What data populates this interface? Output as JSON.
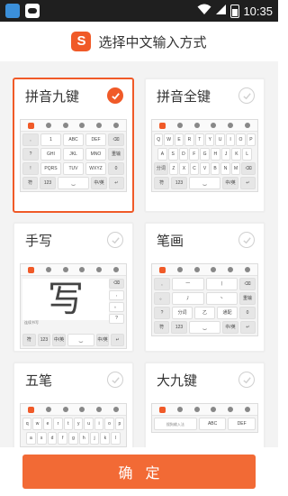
{
  "status_bar": {
    "time": "10:35"
  },
  "header": {
    "logo_char": "S",
    "title": "选择中文输入方式"
  },
  "colors": {
    "accent": "#f05a28",
    "button": "#f26a35"
  },
  "options": [
    {
      "title": "拼音九键",
      "selected": true,
      "keyboard": {
        "rows": [
          [
            ",",
            "1",
            "ABC",
            "DEF",
            "⌫"
          ],
          [
            "?",
            "GHI",
            "JKL",
            "MNO",
            "重输"
          ],
          [
            "!",
            "PQRS",
            "TUV",
            "WXYZ",
            "0"
          ],
          [
            "符",
            "123",
            "‿",
            "中/英",
            "↵"
          ]
        ]
      }
    },
    {
      "title": "拼音全键",
      "selected": false,
      "keyboard": {
        "rows": [
          [
            "Q",
            "W",
            "E",
            "R",
            "T",
            "Y",
            "U",
            "I",
            "O",
            "P"
          ],
          [
            "A",
            "S",
            "D",
            "F",
            "G",
            "H",
            "J",
            "K",
            "L"
          ],
          [
            "分词",
            "Z",
            "X",
            "C",
            "V",
            "B",
            "N",
            "M",
            "⌫"
          ],
          [
            "符",
            "123",
            "‿",
            "中/英",
            "↵"
          ]
        ]
      }
    },
    {
      "title": "手写",
      "selected": false,
      "handwriting_char": "写",
      "handwriting_caption": "连续书写",
      "side_keys": [
        "⌫",
        ",",
        "。",
        "?",
        "!"
      ],
      "bottom_keys": [
        "符",
        "123",
        "中/英",
        "‿",
        "中/英",
        "↵"
      ]
    },
    {
      "title": "笔画",
      "selected": false,
      "keyboard": {
        "rows": [
          [
            ",",
            "一",
            "丨",
            "⌫"
          ],
          [
            "。",
            "丿",
            "丶",
            "重输"
          ],
          [
            "?",
            "分词",
            "乙",
            "通配",
            "0"
          ],
          [
            "符",
            "123",
            "‿",
            "中/英",
            "↵"
          ]
        ]
      }
    },
    {
      "title": "五笔",
      "selected": false,
      "keyboard": {
        "rows": [
          [
            "q",
            "w",
            "e",
            "r",
            "t",
            "y",
            "u",
            "i",
            "o",
            "p"
          ],
          [
            "a",
            "s",
            "d",
            "f",
            "g",
            "h",
            "j",
            "k",
            "l"
          ]
        ]
      }
    },
    {
      "title": "大九键",
      "selected": false,
      "keyboard": {
        "placeholder": "搜狗输入法",
        "rows": [
          [
            "ABC",
            "DEF"
          ]
        ]
      }
    }
  ],
  "footer": {
    "confirm_label": "确定"
  }
}
